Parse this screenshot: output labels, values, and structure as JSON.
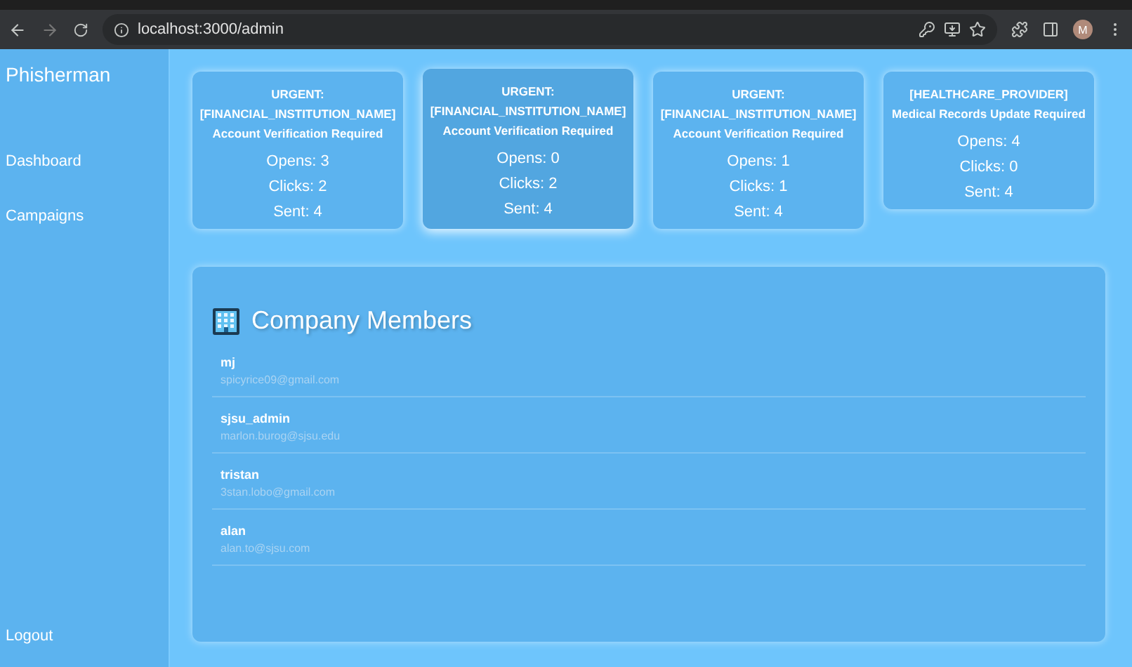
{
  "browser": {
    "url": "localhost:3000/admin",
    "profile_initial": "M"
  },
  "sidebar": {
    "brand": "Phisherman",
    "items": [
      {
        "label": "Dashboard"
      },
      {
        "label": "Campaigns"
      }
    ],
    "logout": "Logout"
  },
  "campaigns": [
    {
      "title": "URGENT: [FINANCIAL_INSTITUTION_NAME] Account Verification Required",
      "opens": "Opens: 3",
      "clicks": "Clicks: 2",
      "sent": "Sent: 4",
      "highlighted": false
    },
    {
      "title": "URGENT: [FINANCIAL_INSTITUTION_NAME] Account Verification Required",
      "opens": "Opens: 0",
      "clicks": "Clicks: 2",
      "sent": "Sent: 4",
      "highlighted": true
    },
    {
      "title": "URGENT: [FINANCIAL_INSTITUTION_NAME] Account Verification Required",
      "opens": "Opens: 1",
      "clicks": "Clicks: 1",
      "sent": "Sent: 4",
      "highlighted": false
    },
    {
      "title": "[HEALTHCARE_PROVIDER] Medical Records Update Required",
      "opens": "Opens: 4",
      "clicks": "Clicks: 0",
      "sent": "Sent: 4",
      "highlighted": false
    }
  ],
  "members_panel": {
    "title": "Company Members",
    "members": [
      {
        "name": "mj",
        "email": "spicyrice09@gmail.com"
      },
      {
        "name": "sjsu_admin",
        "email": "marlon.burog@sjsu.edu"
      },
      {
        "name": "tristan",
        "email": "3stan.lobo@gmail.com"
      },
      {
        "name": "alan",
        "email": "alan.to@sjsu.com"
      }
    ]
  }
}
